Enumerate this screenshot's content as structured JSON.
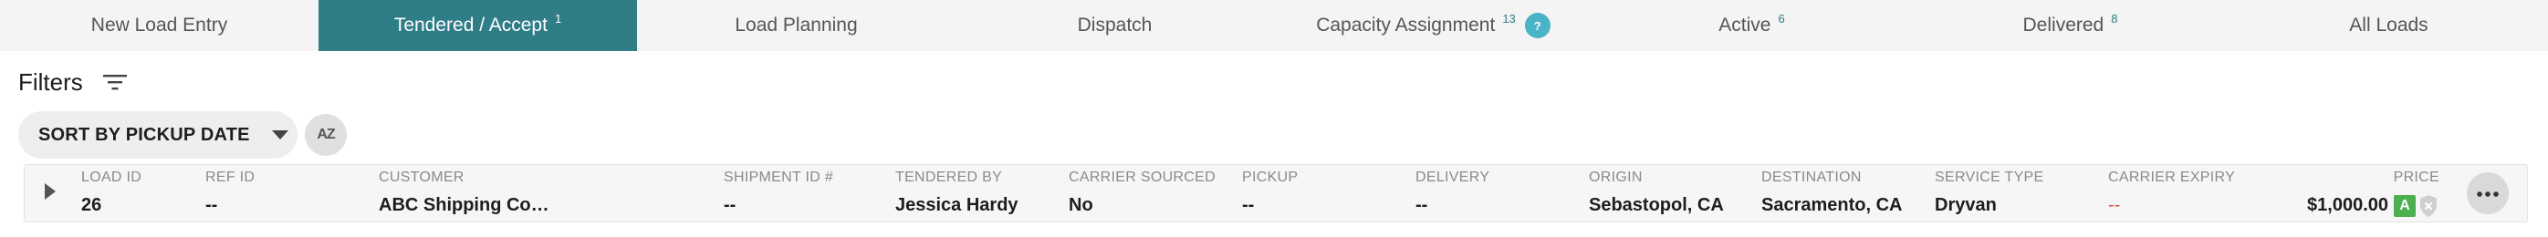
{
  "tabs": [
    {
      "label": "New Load Entry",
      "count": ""
    },
    {
      "label": "Tendered / Accept",
      "count": "1"
    },
    {
      "label": "Load Planning",
      "count": ""
    },
    {
      "label": "Dispatch",
      "count": ""
    },
    {
      "label": "Capacity Assignment",
      "count": "13"
    },
    {
      "label": "Active",
      "count": "6"
    },
    {
      "label": "Delivered",
      "count": "8"
    },
    {
      "label": "All Loads",
      "count": ""
    }
  ],
  "help_badge": "?",
  "filters": {
    "title": "Filters"
  },
  "sort": {
    "label": "SORT BY PICKUP DATE",
    "az_label": "AZ"
  },
  "row": {
    "columns": {
      "load_id": {
        "header": "LOAD ID",
        "value": "26"
      },
      "ref_id": {
        "header": "REF ID",
        "value": "--"
      },
      "customer": {
        "header": "CUSTOMER",
        "value": "ABC Shipping Co…"
      },
      "shipment_id": {
        "header": "SHIPMENT ID #",
        "value": "--"
      },
      "tendered_by": {
        "header": "TENDERED BY",
        "value": "Jessica Hardy"
      },
      "carrier_sourced": {
        "header": "CARRIER SOURCED",
        "value": "No"
      },
      "pickup": {
        "header": "PICKUP",
        "value": "--"
      },
      "delivery": {
        "header": "DELIVERY",
        "value": "--"
      },
      "origin": {
        "header": "ORIGIN",
        "value": "Sebastopol, CA"
      },
      "destination": {
        "header": "DESTINATION",
        "value": "Sacramento, CA"
      },
      "service_type": {
        "header": "SERVICE TYPE",
        "value": "Dryvan"
      },
      "carrier_expiry": {
        "header": "CARRIER EXPIRY",
        "value": "--"
      }
    },
    "price": {
      "header": "PRICE",
      "value": "$1,000.00",
      "badge": "A"
    }
  },
  "colors": {
    "accent": "#2f7d87",
    "help": "#4ab3c8",
    "expiry_red": "#d9534f",
    "badge_green": "#4caf50"
  }
}
